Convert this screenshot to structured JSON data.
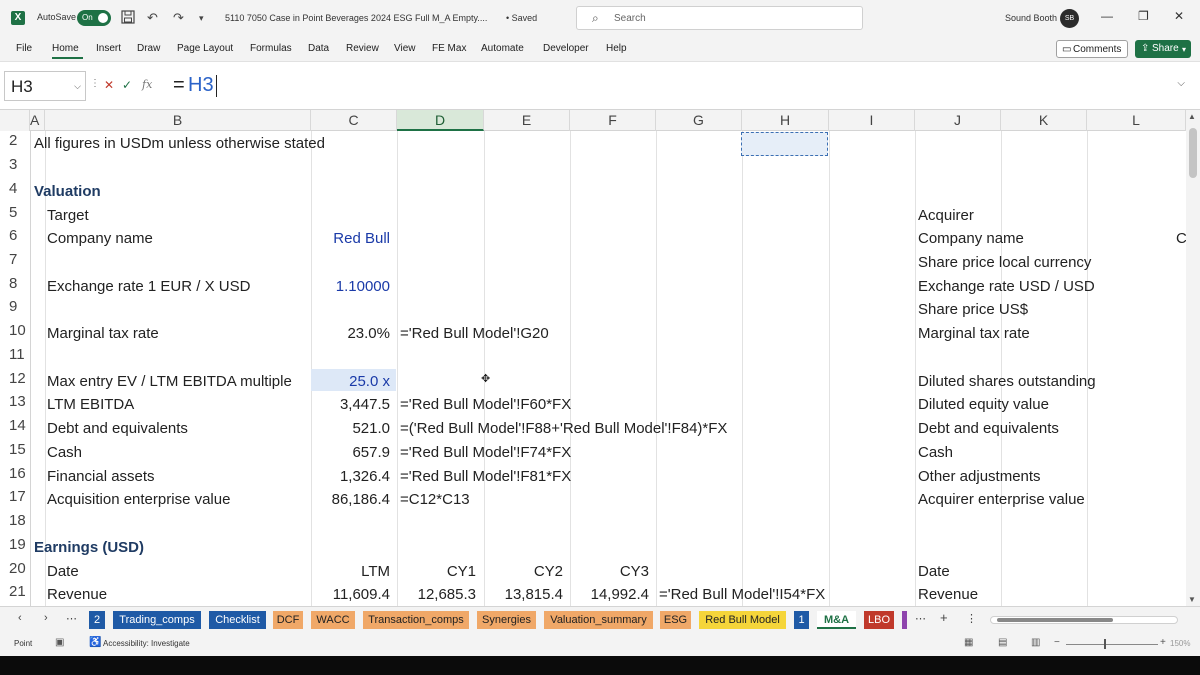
{
  "titlebar": {
    "app_letter": "X",
    "autosave_label": "AutoSave",
    "autosave_state": "On",
    "doc_title": "5110 7050 Case in Point Beverages 2024 ESG Full M_A Empty....",
    "saved_status": "• Saved",
    "search_placeholder": "Search",
    "user_name": "Sound Booth",
    "user_initials": "SB"
  },
  "menu": {
    "items": [
      "File",
      "Home",
      "Insert",
      "Draw",
      "Page Layout",
      "Formulas",
      "Data",
      "Review",
      "View",
      "FE Max",
      "Automate",
      "Developer",
      "Help"
    ],
    "active": "Home",
    "comments_label": "Comments",
    "share_label": "Share"
  },
  "formula_bar": {
    "name_box": "H3",
    "formula_eq": "=",
    "formula_ref": "H3"
  },
  "columns": [
    "A",
    "B",
    "C",
    "D",
    "E",
    "F",
    "G",
    "H",
    "I",
    "J",
    "K",
    "L"
  ],
  "selected_column": "D",
  "rows": [
    "2",
    "3",
    "4",
    "5",
    "6",
    "7",
    "8",
    "9",
    "10",
    "11",
    "12",
    "13",
    "14",
    "15",
    "16",
    "17",
    "18",
    "19",
    "20",
    "21"
  ],
  "cells": {
    "r2": "All figures in USDm unless otherwise stated",
    "r4": "Valuation",
    "r5_b": "Target",
    "r5_j": "Acquirer",
    "r6_b": "Company name",
    "r6_c": "Red Bull",
    "r6_j": "Company name",
    "r6_l": "C",
    "r7_j": "Share price local currency",
    "r8_b": "Exchange rate 1 EUR / X USD",
    "r8_c": "1.10000",
    "r8_j": "Exchange rate USD / USD",
    "r9_j": "Share price US$",
    "r10_b": "Marginal tax rate",
    "r10_c": "23.0%",
    "r10_d": "='Red Bull Model'!G20",
    "r10_j": "Marginal tax rate",
    "r12_b": "Max entry EV / LTM EBITDA multiple",
    "r12_c": "25.0 x",
    "r12_j": "Diluted shares outstanding",
    "r13_b": "LTM EBITDA",
    "r13_c": "3,447.5",
    "r13_d": "='Red Bull Model'!F60*FX",
    "r13_j": "Diluted equity value",
    "r14_b": "Debt and equivalents",
    "r14_c": "521.0",
    "r14_d": "=('Red Bull Model'!F88+'Red Bull Model'!F84)*FX",
    "r14_j": "Debt and equivalents",
    "r15_b": "Cash",
    "r15_c": "657.9",
    "r15_d": "='Red Bull Model'!F74*FX",
    "r15_j": "Cash",
    "r16_b": "Financial assets",
    "r16_c": "1,326.4",
    "r16_d": "='Red Bull Model'!F81*FX",
    "r16_j": "Other adjustments",
    "r17_b": "Acquisition enterprise value",
    "r17_c": "86,186.4",
    "r17_d": "=C12*C13",
    "r17_j": "Acquirer enterprise value",
    "r19": "Earnings (USD)",
    "r20_b": "Date",
    "r20_c": "LTM",
    "r20_d": "CY1",
    "r20_e": "CY2",
    "r20_f": "CY3",
    "r20_j": "Date",
    "r21_b": "Revenue",
    "r21_c": "11,609.4",
    "r21_d": "12,685.3",
    "r21_e": "13,815.4",
    "r21_f": "14,992.4",
    "r21_g": "='Red Bull Model'!I54*FX",
    "r21_j": "Revenue"
  },
  "tabs": [
    {
      "label": "2",
      "color": "#1f5aa6",
      "text": "#ffffff"
    },
    {
      "label": "Trading_comps",
      "color": "#1f5aa6",
      "text": "#ffffff"
    },
    {
      "label": "Checklist",
      "color": "#1f5aa6",
      "text": "#ffffff"
    },
    {
      "label": "DCF",
      "color": "#f0a868",
      "text": "#222222"
    },
    {
      "label": "WACC",
      "color": "#f0a868",
      "text": "#222222"
    },
    {
      "label": "Transaction_comps",
      "color": "#f0a868",
      "text": "#222222"
    },
    {
      "label": "Synergies",
      "color": "#f0a868",
      "text": "#222222"
    },
    {
      "label": "Valuation_summary",
      "color": "#f0a868",
      "text": "#222222"
    },
    {
      "label": "ESG",
      "color": "#f0a868",
      "text": "#222222"
    },
    {
      "label": "Red Bull Model",
      "color": "#f5d53a",
      "text": "#222222"
    },
    {
      "label": "1",
      "color": "#1f5aa6",
      "text": "#ffffff"
    },
    {
      "label": "M&A",
      "color": "#ffffff",
      "text": "#1e7145"
    },
    {
      "label": "LBO",
      "color": "#c0392b",
      "text": "#ffffff"
    }
  ],
  "statusbar": {
    "mode": "Point",
    "accessibility": "Accessibility: Investigate",
    "zoom": "150%"
  }
}
